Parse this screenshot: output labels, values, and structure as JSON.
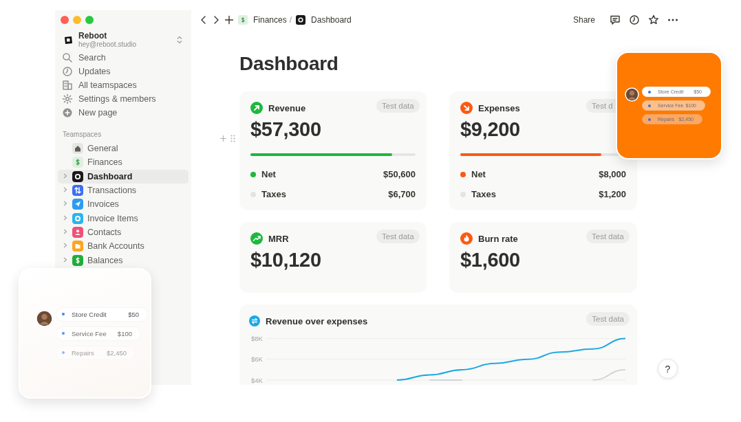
{
  "sidebar": {
    "workspace": {
      "name": "Reboot",
      "email": "hey@reboot.studio"
    },
    "nav": [
      {
        "label": "Search"
      },
      {
        "label": "Updates"
      },
      {
        "label": "All teamspaces"
      },
      {
        "label": "Settings & members"
      },
      {
        "label": "New page"
      }
    ],
    "section_title": "Teamspaces",
    "teamspaces": [
      {
        "label": "General",
        "selected": false,
        "expandable": false
      },
      {
        "label": "Finances",
        "selected": false,
        "expandable": false
      },
      {
        "label": "Dashboard",
        "selected": true,
        "expandable": true
      },
      {
        "label": "Transactions",
        "selected": false,
        "expandable": true
      },
      {
        "label": "Invoices",
        "selected": false,
        "expandable": true
      },
      {
        "label": "Invoice Items",
        "selected": false,
        "expandable": true
      },
      {
        "label": "Contacts",
        "selected": false,
        "expandable": true
      },
      {
        "label": "Bank Accounts",
        "selected": false,
        "expandable": true
      },
      {
        "label": "Balances",
        "selected": false,
        "expandable": true
      }
    ]
  },
  "topbar": {
    "breadcrumbs": [
      {
        "label": "Finances"
      },
      {
        "label": "Dashboard"
      }
    ],
    "separator": "/",
    "share": "Share"
  },
  "page": {
    "title": "Dashboard",
    "metrics": [
      {
        "title": "Revenue",
        "value": "$57,300",
        "badge": "Test data",
        "color": "#1db83f",
        "level": 0.86,
        "rows": [
          {
            "label": "Net",
            "amount": "$50,600",
            "color": "#1db83f"
          },
          {
            "label": "Taxes",
            "amount": "$6,700",
            "color": "#e4e4e4"
          }
        ]
      },
      {
        "title": "Expenses",
        "value": "$9,200",
        "badge": "Test d",
        "color": "#fb5a12",
        "level": 0.85,
        "rows": [
          {
            "label": "Net",
            "amount": "$8,000",
            "color": "#fb5a12"
          },
          {
            "label": "Taxes",
            "amount": "$1,200",
            "color": "#e4e4e4"
          }
        ]
      },
      {
        "title": "MRR",
        "value": "$10,120",
        "badge": "Test data",
        "color": "#1db83f"
      },
      {
        "title": "Burn rate",
        "value": "$1,600",
        "badge": "Test data",
        "color": "#fb5a12"
      }
    ],
    "chart": {
      "title": "Revenue over expenses",
      "badge": "Test data",
      "chart_data": {
        "type": "line",
        "grid": true,
        "ylim": [
          4000,
          8000
        ],
        "yticks": [
          {
            "value": 4000,
            "label": "$4K"
          },
          {
            "value": 6000,
            "label": "$6K"
          },
          {
            "value": 8000,
            "label": "$8K"
          }
        ],
        "series": [
          {
            "color": "#1aa9e3",
            "values": [
              null,
              null,
              null,
              null,
              4000,
              4500,
              5000,
              5600,
              6000,
              6700,
              7000,
              8000
            ]
          },
          {
            "color": "#c4ccd2",
            "values": [
              null,
              null,
              null,
              null,
              null,
              4000,
              4000,
              null,
              null,
              null,
              4000,
              5000
            ]
          }
        ]
      }
    }
  },
  "float_cards": [
    {
      "kind": "light",
      "entries": [
        {
          "label": "Store Credit",
          "amount": "$50"
        },
        {
          "label": "Service Fee",
          "amount": "$100"
        },
        {
          "label": "Repairs",
          "amount": "$2,450"
        }
      ]
    },
    {
      "kind": "orange",
      "entries": [
        {
          "label": "Store Credit",
          "amount": "$50"
        },
        {
          "label": "Service Fee",
          "amount": "$100"
        },
        {
          "label": "Repairs",
          "amount": "$2,450"
        }
      ]
    }
  ],
  "help": {
    "label": "?"
  }
}
